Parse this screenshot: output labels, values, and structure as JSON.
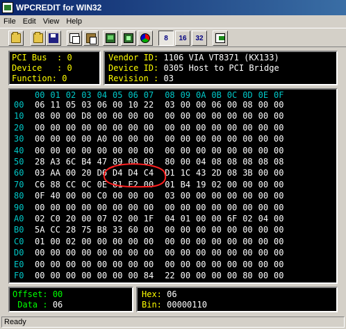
{
  "window": {
    "title": "WPCREDIT for WIN32"
  },
  "menu": [
    "File",
    "Edit",
    "View",
    "Help"
  ],
  "toolbar": {
    "buttons": [
      {
        "name": "open-icon"
      },
      {
        "name": "open-icon"
      },
      {
        "name": "save-icon"
      },
      {
        "name": "copy-icon"
      },
      {
        "name": "paste-icon"
      },
      {
        "name": "pci-icon"
      },
      {
        "name": "chip-icon"
      },
      {
        "name": "color-icon"
      }
    ],
    "width_8": "8",
    "width_16": "16",
    "width_32": "32",
    "selected_width": "8"
  },
  "device_info": {
    "pci_bus_label": "PCI Bus  :",
    "pci_bus": "0",
    "device_label": "Device   :",
    "device": "0",
    "function_label": "Function:",
    "function": "0",
    "vendor_id_label": "Vendor ID:",
    "vendor_id": "1106",
    "vendor_name": "VIA VT8371 (KX133)",
    "device_id_label": "Device ID:",
    "device_id": "0305",
    "device_name": "Host to PCI Bridge",
    "revision_label": "Revision :",
    "revision": "03"
  },
  "hex_grid": {
    "columns": [
      "00",
      "01",
      "02",
      "03",
      "04",
      "05",
      "06",
      "07",
      "08",
      "09",
      "0A",
      "0B",
      "0C",
      "0D",
      "0E",
      "0F"
    ],
    "rows": [
      {
        "addr": "00",
        "bytes": [
          "06",
          "11",
          "05",
          "03",
          "06",
          "00",
          "10",
          "22",
          "03",
          "00",
          "00",
          "06",
          "00",
          "08",
          "00",
          "00"
        ]
      },
      {
        "addr": "10",
        "bytes": [
          "08",
          "00",
          "00",
          "D8",
          "00",
          "00",
          "00",
          "00",
          "00",
          "00",
          "00",
          "00",
          "00",
          "00",
          "00",
          "00"
        ]
      },
      {
        "addr": "20",
        "bytes": [
          "00",
          "00",
          "00",
          "00",
          "00",
          "00",
          "00",
          "00",
          "00",
          "00",
          "00",
          "00",
          "00",
          "00",
          "00",
          "00"
        ]
      },
      {
        "addr": "30",
        "bytes": [
          "00",
          "00",
          "00",
          "00",
          "A0",
          "00",
          "00",
          "00",
          "00",
          "00",
          "00",
          "00",
          "00",
          "00",
          "00",
          "00"
        ]
      },
      {
        "addr": "40",
        "bytes": [
          "00",
          "00",
          "00",
          "00",
          "00",
          "00",
          "00",
          "00",
          "00",
          "00",
          "00",
          "00",
          "00",
          "00",
          "00",
          "00"
        ]
      },
      {
        "addr": "50",
        "bytes": [
          "28",
          "A3",
          "6C",
          "B4",
          "47",
          "89",
          "08",
          "08",
          "80",
          "00",
          "04",
          "08",
          "08",
          "08",
          "08",
          "08"
        ]
      },
      {
        "addr": "60",
        "bytes": [
          "03",
          "AA",
          "00",
          "20",
          "D6",
          "D4",
          "D4",
          "C4",
          "D1",
          "1C",
          "43",
          "2D",
          "08",
          "3B",
          "00",
          "00"
        ]
      },
      {
        "addr": "70",
        "bytes": [
          "C6",
          "88",
          "CC",
          "0C",
          "0E",
          "81",
          "E2",
          "00",
          "01",
          "B4",
          "19",
          "02",
          "00",
          "00",
          "00",
          "00"
        ]
      },
      {
        "addr": "80",
        "bytes": [
          "0F",
          "40",
          "00",
          "00",
          "C0",
          "00",
          "00",
          "00",
          "03",
          "00",
          "00",
          "00",
          "00",
          "00",
          "00",
          "00"
        ]
      },
      {
        "addr": "90",
        "bytes": [
          "00",
          "00",
          "00",
          "00",
          "00",
          "00",
          "00",
          "00",
          "00",
          "00",
          "00",
          "00",
          "00",
          "00",
          "00",
          "00"
        ]
      },
      {
        "addr": "A0",
        "bytes": [
          "02",
          "C0",
          "20",
          "00",
          "07",
          "02",
          "00",
          "1F",
          "04",
          "01",
          "00",
          "00",
          "6F",
          "02",
          "04",
          "00"
        ]
      },
      {
        "addr": "B0",
        "bytes": [
          "5A",
          "CC",
          "28",
          "75",
          "B8",
          "33",
          "60",
          "00",
          "00",
          "00",
          "00",
          "00",
          "00",
          "00",
          "00",
          "00"
        ]
      },
      {
        "addr": "C0",
        "bytes": [
          "01",
          "00",
          "02",
          "00",
          "00",
          "00",
          "00",
          "00",
          "00",
          "00",
          "00",
          "00",
          "00",
          "00",
          "00",
          "00"
        ]
      },
      {
        "addr": "D0",
        "bytes": [
          "00",
          "00",
          "00",
          "00",
          "00",
          "00",
          "00",
          "00",
          "00",
          "00",
          "00",
          "00",
          "00",
          "00",
          "00",
          "00"
        ]
      },
      {
        "addr": "E0",
        "bytes": [
          "00",
          "00",
          "00",
          "00",
          "00",
          "00",
          "00",
          "00",
          "00",
          "00",
          "00",
          "00",
          "00",
          "00",
          "00",
          "00"
        ]
      },
      {
        "addr": "F0",
        "bytes": [
          "00",
          "00",
          "00",
          "00",
          "00",
          "00",
          "00",
          "84",
          "22",
          "00",
          "00",
          "00",
          "00",
          "80",
          "00",
          "00"
        ]
      }
    ],
    "selected_cell": {
      "row": "00",
      "col": "00"
    },
    "highlight_color": "#ff2020"
  },
  "cursor_info": {
    "offset_label": "Offset:",
    "offset": "00",
    "data_label": " Data :",
    "data": "06",
    "hex_label": "Hex:",
    "hex": "06",
    "bin_label": "Bin:",
    "bin": "00000110"
  },
  "status": {
    "text": "Ready"
  }
}
